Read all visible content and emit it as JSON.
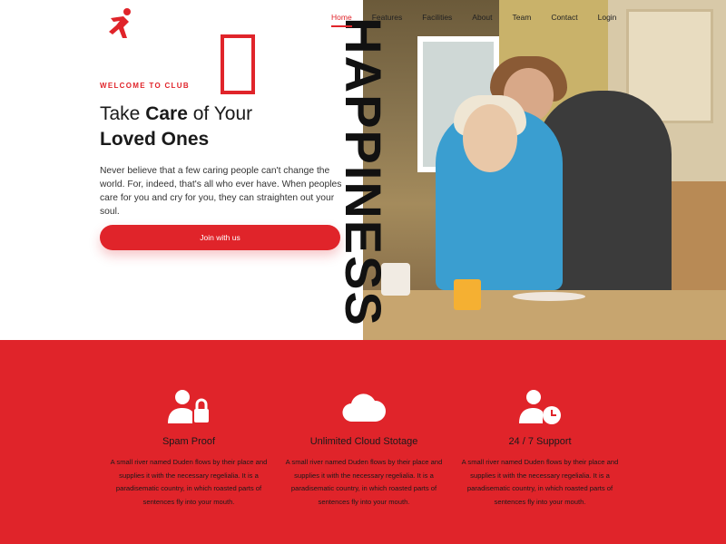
{
  "brand": {
    "logo_icon": "runner-logo-icon",
    "accent": "#e0242a"
  },
  "nav": {
    "items": [
      {
        "label": "Home",
        "active": true
      },
      {
        "label": "Features"
      },
      {
        "label": "Facilities"
      },
      {
        "label": "About"
      },
      {
        "label": "Team"
      },
      {
        "label": "Contact"
      },
      {
        "label": "Login"
      }
    ]
  },
  "hero": {
    "eyebrow": "WELCOME TO CLUB",
    "headline_pre": "Take ",
    "headline_bold": "Care",
    "headline_post": " of Your",
    "headline_line2": "Loved Ones",
    "body": "Never believe that a few caring people can't change the world. For, indeed, that's all who ever have. When peoples care for you and cry for you, they can straighten out your soul.",
    "cta_label": "Join with us",
    "vertical_word": "HAPPINESS"
  },
  "features": [
    {
      "icon": "user-lock-icon",
      "title": "Spam Proof",
      "text": "A small river named Duden flows by their place and supplies it with the necessary regelialia. It is a paradisematic country, in which roasted parts of sentences fly into your mouth."
    },
    {
      "icon": "cloud-icon",
      "title": "Unlimited Cloud Stotage",
      "text": "A small river named Duden flows by their place and supplies it with the necessary regelialia. It is a paradisematic country, in which roasted parts of sentences fly into your mouth."
    },
    {
      "icon": "user-clock-icon",
      "title": "24 / 7 Support",
      "text": "A small river named Duden flows by their place and supplies it with the necessary regelialia. It is a paradisematic country, in which roasted parts of sentences fly into your mouth."
    }
  ]
}
